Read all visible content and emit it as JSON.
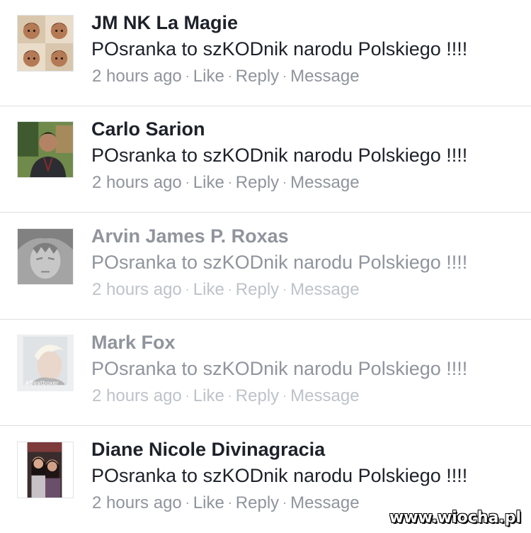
{
  "comments": [
    {
      "name": "JM NK La Magie",
      "text": "POsranka to szKODnik narodu Polskiego !!!!",
      "time": "2 hours ago",
      "like": "Like",
      "reply": "Reply",
      "message": "Message",
      "avatar_icon": "four-baby-photos-avatar"
    },
    {
      "name": "Carlo Sarion",
      "text": "POsranka to szKODnik narodu Polskiego !!!!",
      "time": "2 hours ago",
      "like": "Like",
      "reply": "Reply",
      "message": "Message",
      "avatar_icon": "man-outdoor-avatar"
    },
    {
      "name": "Arvin James P. Roxas",
      "text": "POsranka to szKODnik narodu Polskiego !!!!",
      "time": "2 hours ago",
      "like": "Like",
      "reply": "Reply",
      "message": "Message",
      "avatar_icon": "manga-character-avatar"
    },
    {
      "name": "Mark Fox",
      "text": "POsranka to szKODnik narodu Polskiego !!!!",
      "time": "2 hours ago",
      "like": "Like",
      "reply": "Reply",
      "message": "Message",
      "avatar_icon": "blond-man-avatar",
      "avatar_caption": "#Beatboxer"
    },
    {
      "name": "Diane Nicole Divinagracia",
      "text": "POsranka to szKODnik narodu Polskiego !!!!",
      "time": "2 hours ago",
      "like": "Like",
      "reply": "Reply",
      "message": "Message",
      "avatar_icon": "two-girls-avatar"
    }
  ],
  "separator": "·",
  "watermark": "www.wiocha.pl",
  "colors": {
    "name": "#1d2129",
    "meta": "#90949c",
    "faded_meta": "#bec3c9",
    "divider": "#dcdee3"
  }
}
